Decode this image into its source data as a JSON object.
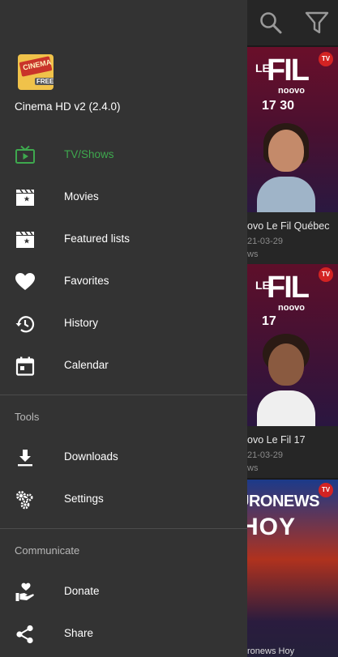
{
  "app": {
    "title": "Cinema HD v2 (2.4.0)",
    "logo_text": "CINEMA",
    "logo_badge": "FREE"
  },
  "topbar": {
    "search_icon": "search-icon",
    "filter_icon": "filter-icon"
  },
  "drawer": {
    "primary_items": [
      {
        "label": "TV/Shows",
        "icon": "tv-icon",
        "active": true
      },
      {
        "label": "Movies",
        "icon": "movie-clapper-icon",
        "active": false
      },
      {
        "label": "Featured lists",
        "icon": "featured-clapper-icon",
        "active": false
      },
      {
        "label": "Favorites",
        "icon": "heart-icon",
        "active": false
      },
      {
        "label": "History",
        "icon": "history-icon",
        "active": false
      },
      {
        "label": "Calendar",
        "icon": "calendar-icon",
        "active": false
      }
    ],
    "tools_header": "Tools",
    "tools_items": [
      {
        "label": "Downloads",
        "icon": "download-icon"
      },
      {
        "label": "Settings",
        "icon": "settings-gears-icon"
      }
    ],
    "communicate_header": "Communicate",
    "communicate_items": [
      {
        "label": "Donate",
        "icon": "donate-hand-heart-icon"
      },
      {
        "label": "Share",
        "icon": "share-icon"
      }
    ]
  },
  "colors": {
    "drawer_bg": "#333333",
    "active_accent": "#3ea84e",
    "text_primary": "#ffffff",
    "section_header": "#b8b8b8"
  },
  "background_cards": [
    {
      "brand_top": "LE",
      "brand_main": "FIL",
      "brand_sub": "noovo",
      "time": "17 30",
      "badge": "TV",
      "title": "ovo Le Fil Québec",
      "date": "21-03-29",
      "type": "ws"
    },
    {
      "brand_top": "LE",
      "brand_main": "FIL",
      "brand_sub": "noovo",
      "time": "17",
      "badge": "TV",
      "title": "ovo Le Fil 17",
      "date": "21-03-29",
      "type": "ws"
    },
    {
      "brand_line1": "URONEWS",
      "brand_line2": "HOY",
      "badge": "TV",
      "title": "ronews Hoy"
    }
  ]
}
